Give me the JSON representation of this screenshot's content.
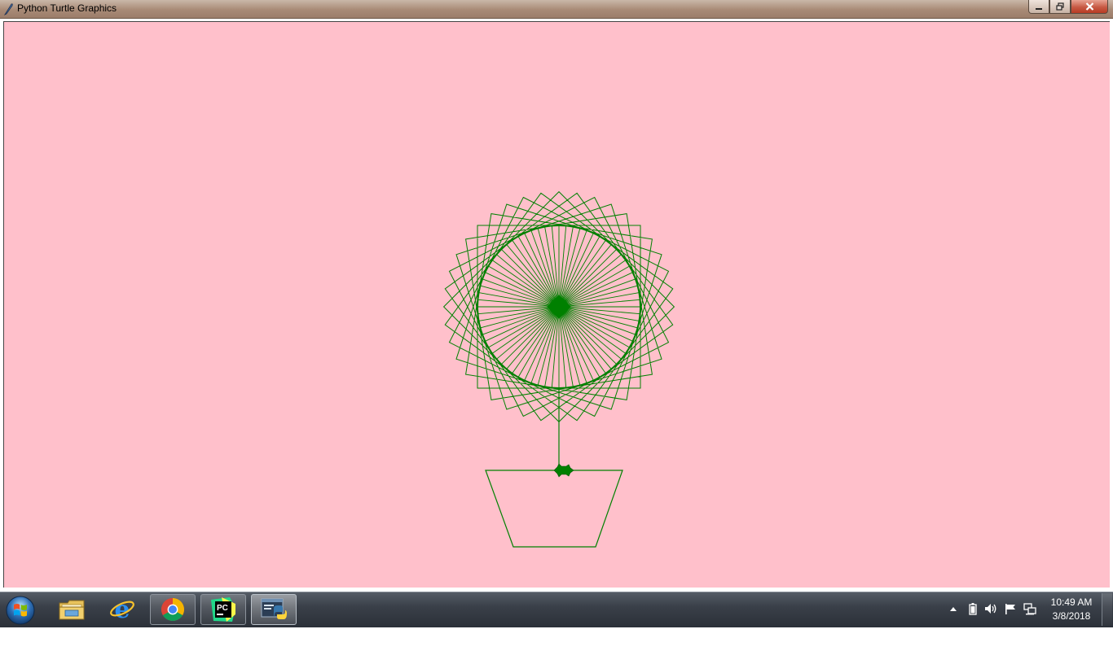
{
  "window": {
    "title": "Python Turtle Graphics",
    "icon": "feather-icon",
    "controls": {
      "minimize": "minimize-icon",
      "restore": "restore-icon",
      "close": "close-icon"
    }
  },
  "canvas": {
    "background": "#ffc0cb",
    "pen_color": "#008000"
  },
  "taskbar": {
    "start": "windows-orb-icon",
    "apps": [
      {
        "name": "file-explorer-icon",
        "state": "pinned"
      },
      {
        "name": "internet-explorer-icon",
        "state": "pinned"
      },
      {
        "name": "chrome-icon",
        "state": "running"
      },
      {
        "name": "pycharm-icon",
        "state": "running",
        "label": "PC"
      },
      {
        "name": "python-icon",
        "state": "active"
      }
    ],
    "tray": [
      "show-hidden-icon",
      "battery-icon",
      "volume-icon",
      "action-center-flag-icon",
      "network-icon"
    ],
    "clock": {
      "time": "10:49 AM",
      "date": "3/8/2018"
    }
  }
}
